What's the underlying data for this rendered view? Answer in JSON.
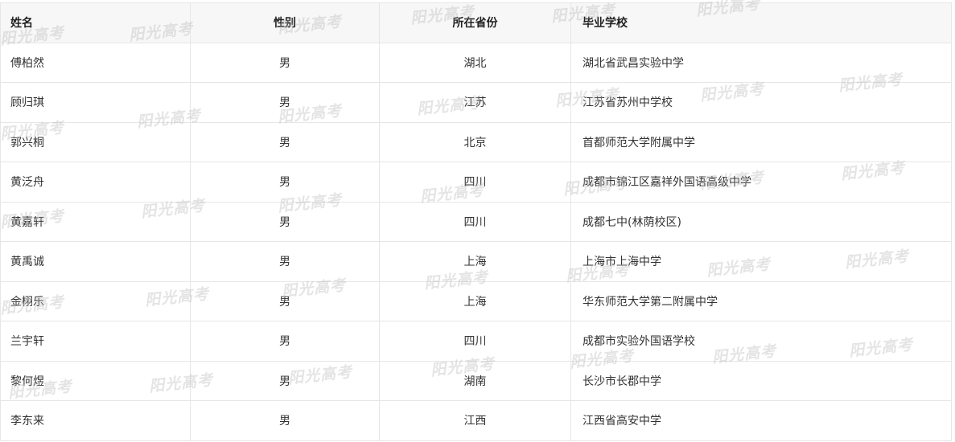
{
  "table": {
    "headers": {
      "name": "姓名",
      "gender": "性别",
      "province": "所在省份",
      "school": "毕业学校"
    },
    "rows": [
      {
        "name": "傅柏然",
        "gender": "男",
        "province": "湖北",
        "school": "湖北省武昌实验中学"
      },
      {
        "name": "顾归琪",
        "gender": "男",
        "province": "江苏",
        "school": "江苏省苏州中学校"
      },
      {
        "name": "郭兴桐",
        "gender": "男",
        "province": "北京",
        "school": "首都师范大学附属中学"
      },
      {
        "name": "黄泛舟",
        "gender": "男",
        "province": "四川",
        "school": "成都市锦江区嘉祥外国语高级中学"
      },
      {
        "name": "黄嘉轩",
        "gender": "男",
        "province": "四川",
        "school": "成都七中(林荫校区)"
      },
      {
        "name": "黄禹诚",
        "gender": "男",
        "province": "上海",
        "school": "上海市上海中学"
      },
      {
        "name": "金栩乐",
        "gender": "男",
        "province": "上海",
        "school": "华东师范大学第二附属中学"
      },
      {
        "name": "兰宇轩",
        "gender": "男",
        "province": "四川",
        "school": "成都市实验外国语学校"
      },
      {
        "name": "黎何煜",
        "gender": "男",
        "province": "湖南",
        "school": "长沙市长郡中学"
      },
      {
        "name": "李东来",
        "gender": "男",
        "province": "江西",
        "school": "江西省高安中学"
      }
    ]
  },
  "watermark": {
    "text": "阳光高考"
  }
}
